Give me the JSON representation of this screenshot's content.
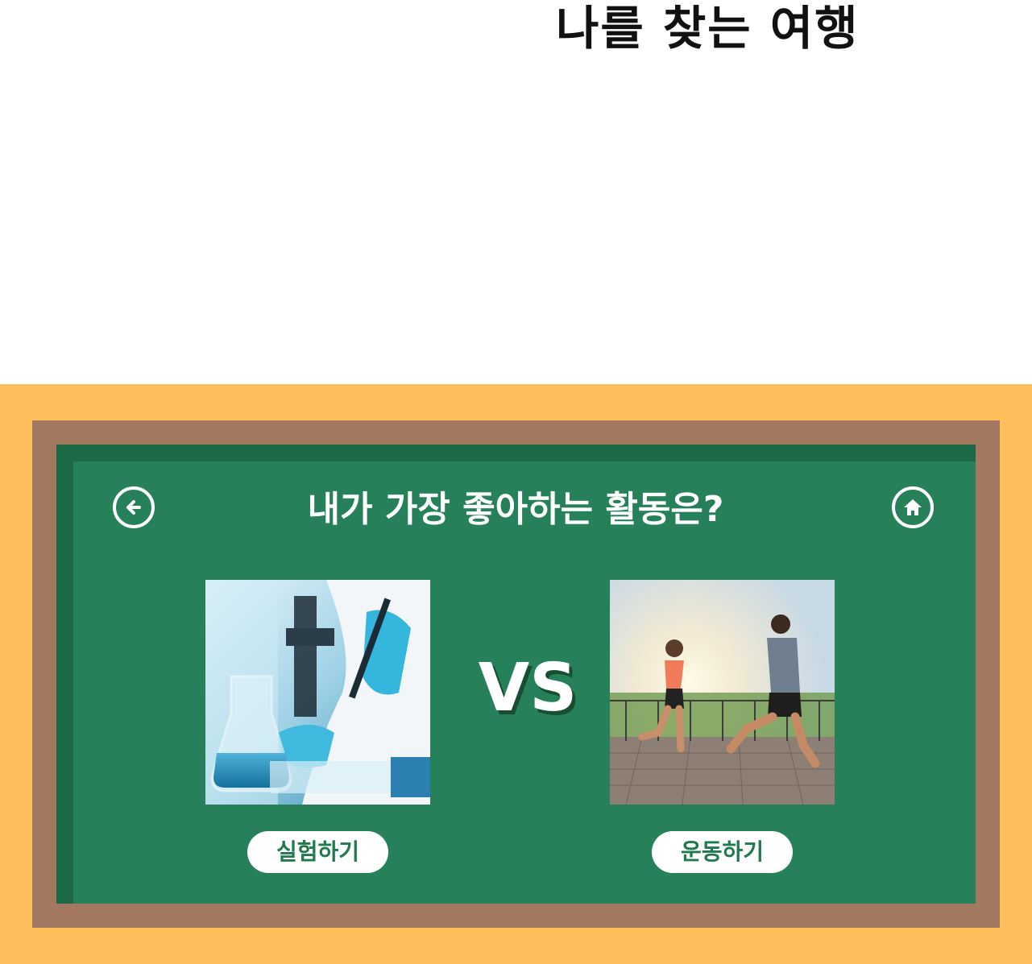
{
  "page": {
    "title": "나를 찾는 여행"
  },
  "quiz": {
    "question": "내가 가장 좋아하는 활동은?",
    "vs_label": "VS",
    "options": [
      {
        "label": "실험하기",
        "image": "laboratory-experiment-photo"
      },
      {
        "label": "운동하기",
        "image": "people-running-photo"
      }
    ]
  },
  "icons": {
    "back": "back-arrow-icon",
    "home": "home-icon"
  },
  "colors": {
    "frame_outer": "#fdbe5b",
    "frame_wood": "#a27860",
    "board": "#26805a",
    "board_shadow": "#1b6a45",
    "button_text": "#1f7a4c"
  }
}
